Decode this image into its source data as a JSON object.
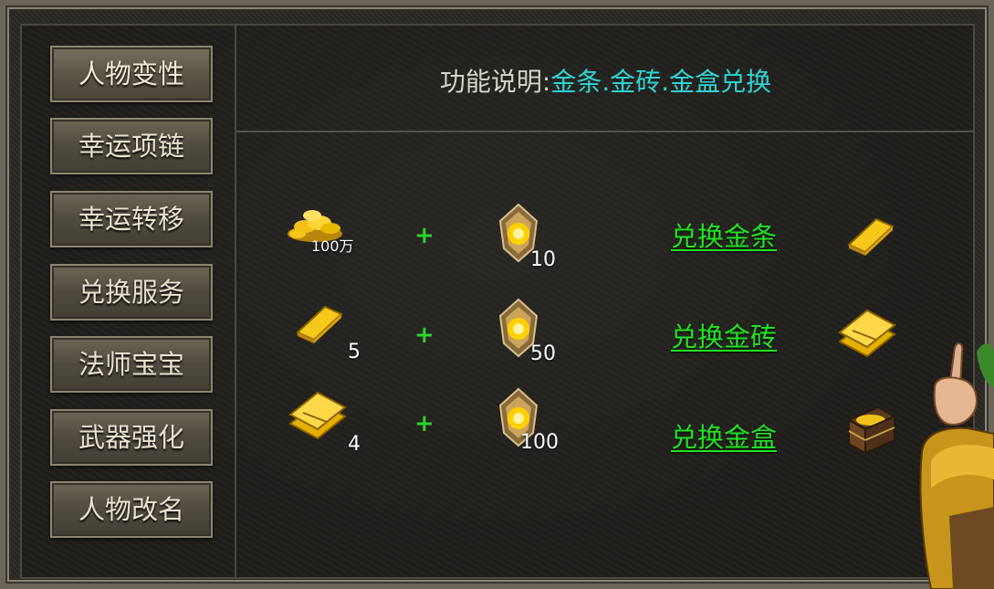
{
  "sidebar": {
    "items": [
      {
        "label": "人物变性",
        "active": true
      },
      {
        "label": "幸运项链"
      },
      {
        "label": "幸运转移"
      },
      {
        "label": "兑换服务"
      },
      {
        "label": "法师宝宝"
      },
      {
        "label": "武器强化"
      },
      {
        "label": "人物改名"
      }
    ]
  },
  "header": {
    "prefix": "功能说明:",
    "highlight": "金条.金砖.金盒兑换"
  },
  "rows": [
    {
      "input_qty": "100万",
      "input_icon": "gold-coins-icon",
      "plus": "+",
      "gem_qty": "10",
      "action": "兑换金条",
      "output_icon": "gold-bar-icon"
    },
    {
      "input_qty": "5",
      "input_icon": "gold-bar-icon",
      "plus": "+",
      "gem_qty": "50",
      "action": "兑换金砖",
      "output_icon": "gold-brick-icon"
    },
    {
      "input_qty": "4",
      "input_icon": "gold-brick-icon",
      "plus": "+",
      "gem_qty": "100",
      "action": "兑换金盒",
      "output_icon": "gold-box-icon"
    }
  ],
  "colors": {
    "highlight": "#2fd3d3",
    "action": "#22e322",
    "plus": "#2bd52b"
  }
}
